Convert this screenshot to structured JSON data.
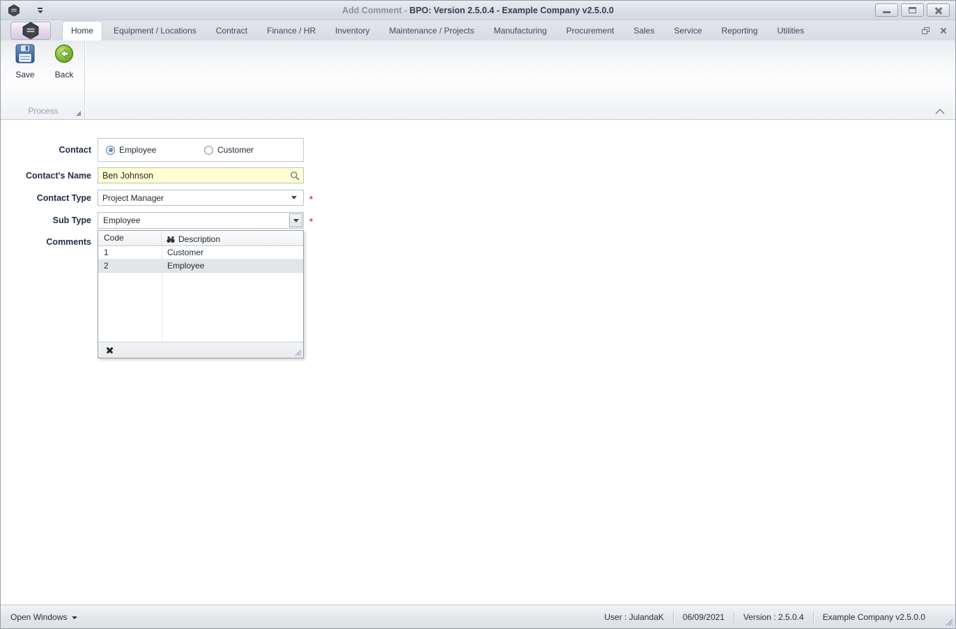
{
  "window": {
    "title_doc": "Add Comment",
    "title_sep": " - ",
    "title_app": "BPO: Version 2.5.0.4 - Example Company v2.5.0.0"
  },
  "ribbon": {
    "tabs": [
      "Home",
      "Equipment / Locations",
      "Contract",
      "Finance / HR",
      "Inventory",
      "Maintenance / Projects",
      "Manufacturing",
      "Procurement",
      "Sales",
      "Service",
      "Reporting",
      "Utilities"
    ],
    "active_tab": "Home",
    "save_label": "Save",
    "back_label": "Back",
    "group_label": "Process"
  },
  "form": {
    "contact_label": "Contact",
    "contact_options": [
      {
        "label": "Employee",
        "selected": true
      },
      {
        "label": "Customer",
        "selected": false
      }
    ],
    "name_label": "Contact's Name",
    "name_value": "Ben Johnson",
    "type_label": "Contact Type",
    "type_value": "Project Manager",
    "type_required": "*",
    "sub_label": "Sub Type",
    "sub_value": "Employee",
    "sub_required": "*",
    "comments_label": "Comments",
    "subtype_dropdown": {
      "columns": [
        "Code",
        "Description"
      ],
      "rows": [
        {
          "code": "1",
          "description": "Customer",
          "selected": false
        },
        {
          "code": "2",
          "description": "Employee",
          "selected": true
        }
      ]
    }
  },
  "statusbar": {
    "open_windows": "Open Windows",
    "user": "User : JulandaK",
    "date": "06/09/2021",
    "version": "Version : 2.5.0.4",
    "company": "Example Company v2.5.0.0"
  },
  "colors": {
    "field_highlight_yellow": "#ffffd2",
    "required_red": "#d9433b",
    "selected_row_gray": "#e2e5e9",
    "back_green": "#76b82a",
    "save_blue": "#3a66a0"
  }
}
